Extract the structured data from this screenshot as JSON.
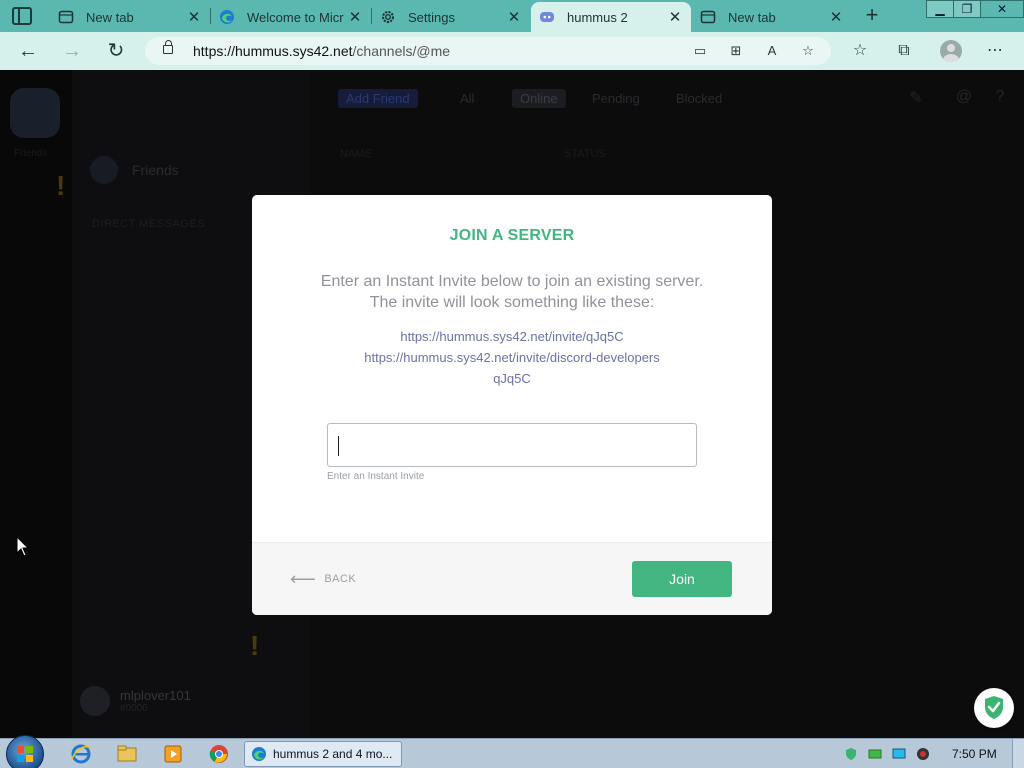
{
  "browser": {
    "tabs": [
      {
        "title": "New tab",
        "icon": "newtab-icon"
      },
      {
        "title": "Welcome to Micr",
        "icon": "edge-icon"
      },
      {
        "title": "Settings",
        "icon": "gear-icon"
      },
      {
        "title": "hummus 2",
        "icon": "discord-icon",
        "active": true
      },
      {
        "title": "New tab",
        "icon": "newtab-icon"
      }
    ],
    "address": {
      "host": "https://hummus.sys42.net",
      "path": "/channels/@me"
    }
  },
  "discord_background": {
    "guild_label": "Friends",
    "dm_friends_label": "Friends",
    "dm_header": "DIRECT MESSAGES",
    "top_tabs": {
      "add_friend": "Add Friend",
      "all": "All",
      "online": "Online",
      "pending": "Pending",
      "blocked": "Blocked"
    },
    "col_name": "NAME",
    "col_status": "STATUS",
    "username": "mlplover101",
    "user_sub": "#0000"
  },
  "modal": {
    "title": "JOIN A SERVER",
    "description": "Enter an Instant Invite below to join an existing server. The invite will look something like these:",
    "examples": [
      "https://hummus.sys42.net/invite/qJq5C",
      "https://hummus.sys42.net/invite/discord-developers",
      "qJq5C"
    ],
    "input_value": "",
    "input_hint": "Enter an Instant Invite",
    "back_label": "BACK",
    "join_label": "Join"
  },
  "taskbar": {
    "task_label": "hummus 2 and 4 mo...",
    "clock": "7:50 PM"
  },
  "colors": {
    "accent_green": "#43b581",
    "titlebar": "#5bb8b0",
    "addressbar": "#d6f0ec"
  }
}
